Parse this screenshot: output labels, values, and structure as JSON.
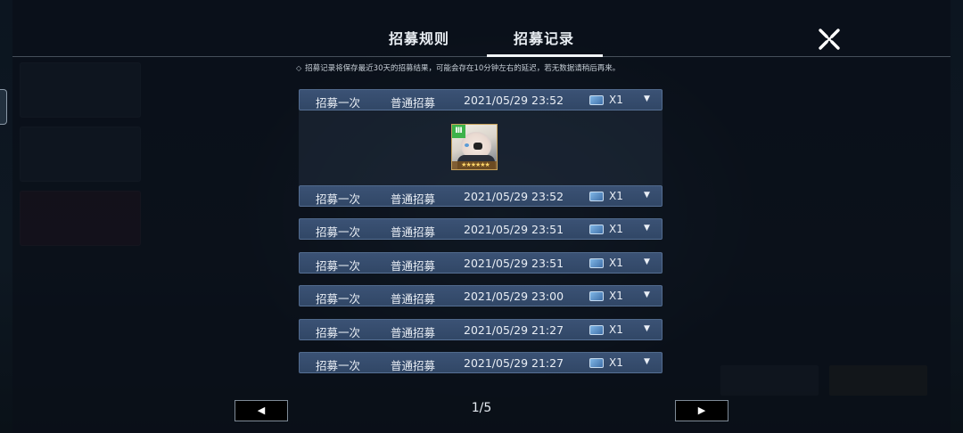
{
  "tabs": [
    {
      "label": "招募规则",
      "active": false
    },
    {
      "label": "招募记录",
      "active": true
    }
  ],
  "close_icon": "close-x-icon",
  "notice": {
    "icon": "diamond-icon",
    "text": "招募记录将保存最近30天的招募结果，可能会存在10分钟左右的延迟，若无数据请稍后再来。"
  },
  "records": [
    {
      "type": "招募一次",
      "pool": "普通招募",
      "time": "2021/05/29 23:52",
      "ticket_icon": "ticket-icon",
      "count": "X1",
      "expanded": true
    },
    {
      "type": "招募一次",
      "pool": "普通招募",
      "time": "2021/05/29 23:52",
      "ticket_icon": "ticket-icon",
      "count": "X1",
      "expanded": false
    },
    {
      "type": "招募一次",
      "pool": "普通招募",
      "time": "2021/05/29 23:51",
      "ticket_icon": "ticket-icon",
      "count": "X1",
      "expanded": false
    },
    {
      "type": "招募一次",
      "pool": "普通招募",
      "time": "2021/05/29 23:51",
      "ticket_icon": "ticket-icon",
      "count": "X1",
      "expanded": false
    },
    {
      "type": "招募一次",
      "pool": "普通招募",
      "time": "2021/05/29 23:00",
      "ticket_icon": "ticket-icon",
      "count": "X1",
      "expanded": false
    },
    {
      "type": "招募一次",
      "pool": "普通招募",
      "time": "2021/05/29 21:27",
      "ticket_icon": "ticket-icon",
      "count": "X1",
      "expanded": false
    },
    {
      "type": "招募一次",
      "pool": "普通招募",
      "time": "2021/05/29 21:27",
      "ticket_icon": "ticket-icon",
      "count": "X1",
      "expanded": false
    }
  ],
  "expanded_result": {
    "character_icon": "character-portrait-icon",
    "badge_icon": "faction-badge-icon",
    "star_count": 6,
    "frame_color": "#c8a25a"
  },
  "pagination": {
    "prev_icon": "left-triangle-icon",
    "next_icon": "right-triangle-icon",
    "page_text": "1/5",
    "current": 1,
    "total": 5
  },
  "colors": {
    "row_bg": "#3b5275",
    "panel_bg": "#0a1018",
    "badge_green": "#3db24a"
  }
}
